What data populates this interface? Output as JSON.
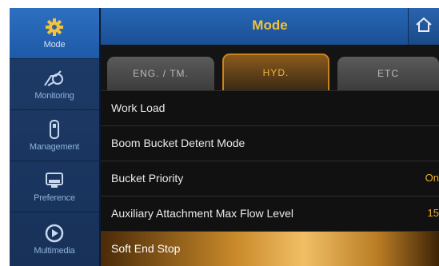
{
  "header": {
    "title": "Mode"
  },
  "sidebar": {
    "items": [
      {
        "label": "Mode",
        "icon": "gear-icon",
        "active": true
      },
      {
        "label": "Monitoring",
        "icon": "monitoring-icon"
      },
      {
        "label": "Management",
        "icon": "management-icon"
      },
      {
        "label": "Preference",
        "icon": "preference-icon"
      },
      {
        "label": "Multimedia",
        "icon": "multimedia-icon"
      }
    ]
  },
  "tabs": [
    {
      "label": "ENG. / TM."
    },
    {
      "label": "HYD.",
      "active": true
    },
    {
      "label": "ETC"
    }
  ],
  "rows": [
    {
      "label": "Work Load",
      "value": ""
    },
    {
      "label": "Boom Bucket Detent Mode",
      "value": ""
    },
    {
      "label": "Bucket Priority",
      "value": "On"
    },
    {
      "label": "Auxiliary Attachment Max Flow Level",
      "value": "15"
    },
    {
      "label": "Soft End Stop",
      "value": "",
      "selected": true
    }
  ],
  "colors": {
    "accent": "#f2c23a",
    "sidebar": "#1e3c6a",
    "header": "#2767b6",
    "selected_row": "#d59a3a"
  }
}
